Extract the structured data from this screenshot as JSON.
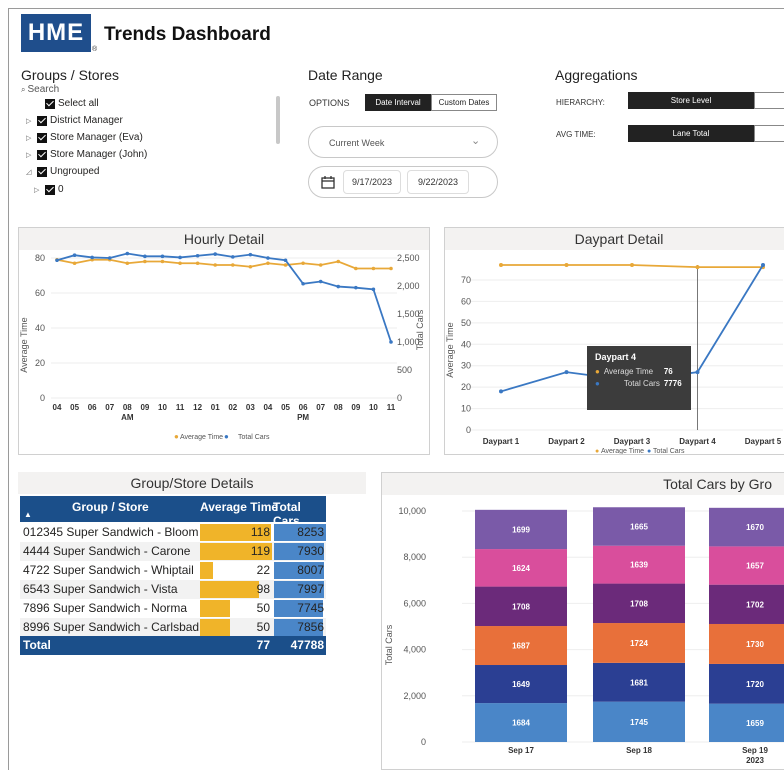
{
  "header": {
    "logo": "HME",
    "logo_mark": "®",
    "title": "Trends Dashboard"
  },
  "groups": {
    "title": "Groups / Stores",
    "search_placeholder": "Search",
    "items": [
      {
        "label": "Select all",
        "expander": ""
      },
      {
        "label": "District Manager",
        "expander": "▷"
      },
      {
        "label": "Store Manager (Eva)",
        "expander": "▷"
      },
      {
        "label": "Store Manager (John)",
        "expander": "▷"
      },
      {
        "label": "Ungrouped",
        "expander": "◿"
      },
      {
        "label": "0",
        "expander": "▷"
      }
    ]
  },
  "date_range": {
    "title": "Date Range",
    "options_label": "OPTIONS",
    "option_selected": "Date Interval",
    "option_other": "Custom Dates",
    "interval_value": "Current Week",
    "start_date": "9/17/2023",
    "end_date": "9/22/2023"
  },
  "aggregations": {
    "title": "Aggregations",
    "hierarchy_label": "HIERARCHY:",
    "hierarchy_value": "Store Level",
    "avg_time_label": "AVG TIME:",
    "avg_time_value": "Lane Total"
  },
  "hourly": {
    "title": "Hourly Detail",
    "y_left_label": "Average Time",
    "y_right_label": "Total Cars",
    "x_ticks": [
      "04",
      "05",
      "06",
      "07",
      "08",
      "09",
      "10",
      "11",
      "12",
      "01",
      "02",
      "03",
      "04",
      "05",
      "06",
      "07",
      "08",
      "09",
      "10",
      "11"
    ],
    "am_label": "AM",
    "pm_label": "PM",
    "left_ticks": [
      "0",
      "20",
      "40",
      "60",
      "80"
    ],
    "right_ticks": [
      "0",
      "500",
      "1,000",
      "1,500",
      "2,000",
      "2,500"
    ],
    "legend_a": "Average Time",
    "legend_b": "Total Cars"
  },
  "daypart": {
    "title": "Daypart Detail",
    "y_label": "Average Time",
    "y_ticks": [
      "0",
      "10",
      "20",
      "30",
      "40",
      "50",
      "60",
      "70"
    ],
    "categories": [
      "Daypart 1",
      "Daypart 2",
      "Daypart 3",
      "Daypart 4",
      "Daypart 5"
    ],
    "legend_a": "Average Time",
    "legend_b": "Total Cars",
    "tooltip": {
      "title": "Daypart 4",
      "a_label": "Average Time",
      "a_value": "76",
      "b_label": "Total Cars",
      "b_value": "7776"
    }
  },
  "table": {
    "title": "Group/Store Details",
    "col_store": "Group / Store",
    "col_avg": "Average Time",
    "col_cars": "Total Cars",
    "rows": [
      {
        "store": "012345 Super Sandwich - Bloom",
        "avg": "118",
        "cars": "8253"
      },
      {
        "store": "4444 Super Sandwich - Carone",
        "avg": "119",
        "cars": "7930"
      },
      {
        "store": "4722 Super Sandwich - Whiptail",
        "avg": "22",
        "cars": "8007"
      },
      {
        "store": "6543 Super Sandwich - Vista",
        "avg": "98",
        "cars": "7997"
      },
      {
        "store": "7896 Super Sandwich - Norma",
        "avg": "50",
        "cars": "7745"
      },
      {
        "store": "8996 Super Sandwich - Carlsbad",
        "avg": "50",
        "cars": "7856"
      }
    ],
    "total_label": "Total",
    "total_avg": "77",
    "total_cars": "47788"
  },
  "stacked": {
    "title": "Total Cars by Gro",
    "y_label": "Total Cars",
    "y_ticks": [
      "0",
      "2,000",
      "4,000",
      "6,000",
      "8,000",
      "10,000"
    ],
    "year": "2023"
  },
  "colors": {
    "brand": "#1f4e8c",
    "orange": "#e8a838",
    "blue": "#3a78c3",
    "table_head": "#1b4f8a",
    "gold_bar": "#f0b429",
    "blue_bar": "#4a86c8"
  },
  "chart_data": [
    {
      "type": "line",
      "title": "Hourly Detail",
      "categories": [
        "04",
        "05",
        "06",
        "07",
        "08",
        "09",
        "10",
        "11",
        "12",
        "01",
        "02",
        "03",
        "04",
        "05",
        "06",
        "07",
        "08",
        "09",
        "10",
        "11"
      ],
      "series": [
        {
          "name": "Average Time",
          "axis": "left",
          "values": [
            79,
            77,
            79,
            79,
            77,
            78,
            78,
            77,
            77,
            76,
            76,
            75,
            77,
            76,
            77,
            76,
            78,
            74,
            74,
            74
          ]
        },
        {
          "name": "Total Cars",
          "axis": "right",
          "values": [
            2460,
            2550,
            2510,
            2500,
            2580,
            2530,
            2530,
            2510,
            2540,
            2570,
            2520,
            2560,
            2500,
            2460,
            2040,
            2080,
            1990,
            1970,
            1940,
            1000
          ]
        }
      ],
      "ylim_left": [
        0,
        80
      ],
      "ylim_right": [
        0,
        2500
      ]
    },
    {
      "type": "line",
      "title": "Daypart Detail",
      "categories": [
        "Daypart 1",
        "Daypart 2",
        "Daypart 3",
        "Daypart 4",
        "Daypart 5"
      ],
      "series": [
        {
          "name": "Average Time",
          "values": [
            77,
            77,
            77,
            76,
            76
          ]
        },
        {
          "name": "Total Cars",
          "values": [
            18,
            27,
            23,
            27,
            77
          ]
        }
      ],
      "ylim": [
        0,
        70
      ]
    },
    {
      "type": "bar",
      "title": "Total Cars by Gro",
      "categories": [
        "Sep 17",
        "Sep 18",
        "Sep 19"
      ],
      "series": [
        {
          "values": [
            1684,
            1745,
            1659
          ],
          "color": "#4a86c8"
        },
        {
          "values": [
            1649,
            1681,
            1720
          ],
          "color": "#2b3f93"
        },
        {
          "values": [
            1687,
            1724,
            1730
          ],
          "color": "#e8703a"
        },
        {
          "values": [
            1708,
            1708,
            1702
          ],
          "color": "#6b2a7a"
        },
        {
          "values": [
            1624,
            1639,
            1657
          ],
          "color": "#d94e9c"
        },
        {
          "values": [
            1699,
            1665,
            1670
          ],
          "color": "#7a5aa8"
        }
      ],
      "ylim": [
        0,
        10000
      ]
    }
  ]
}
